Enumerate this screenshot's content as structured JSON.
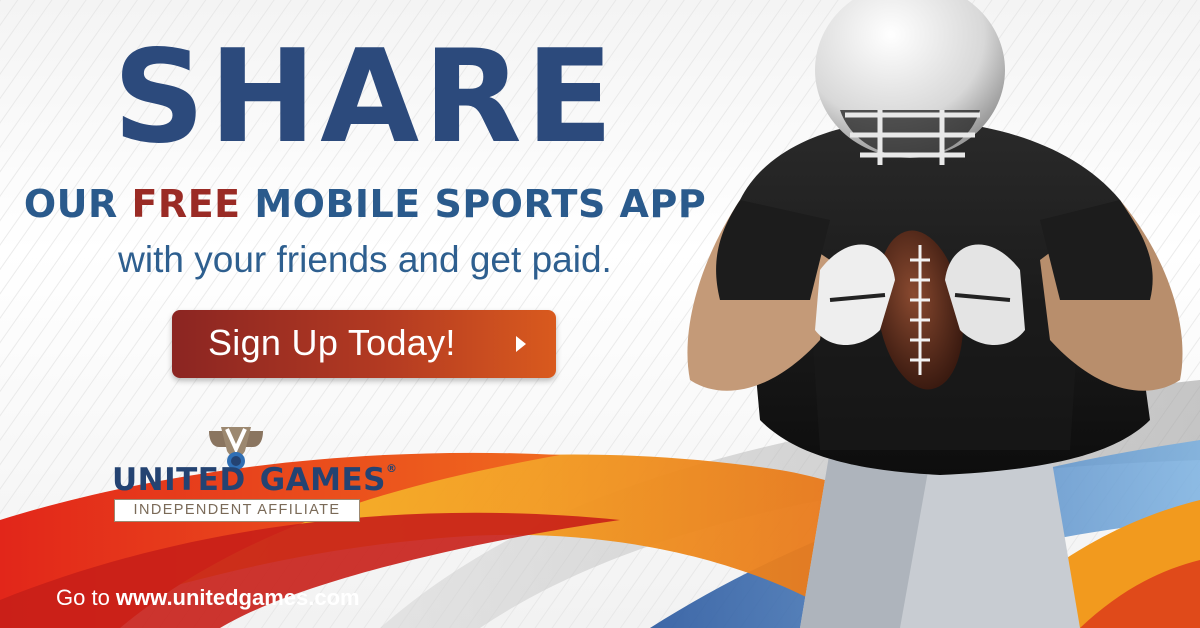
{
  "headline": {
    "main": "SHARE",
    "sub_before": "OUR ",
    "sub_highlight": "FREE",
    "sub_after": " MOBILE SPORTS APP",
    "tagline": "with your friends and get paid."
  },
  "cta": {
    "label": "Sign Up Today!",
    "icon": "play-arrow-icon"
  },
  "logo": {
    "name_left": "UNITED",
    "name_right": "GAMES",
    "registered": "®",
    "badge": "INDEPENDENT AFFILIATE"
  },
  "footer": {
    "prefix": "Go to ",
    "url": "www.unitedgames.com"
  },
  "colors": {
    "headline_blue": "#2c4a7c",
    "highlight_red": "#9a2b25",
    "cta_start": "#8b2522",
    "cta_end": "#d95a1e",
    "swoosh_orange": "#f39a1e",
    "swoosh_red": "#d9261c",
    "swoosh_blue": "#2f6fb5"
  }
}
